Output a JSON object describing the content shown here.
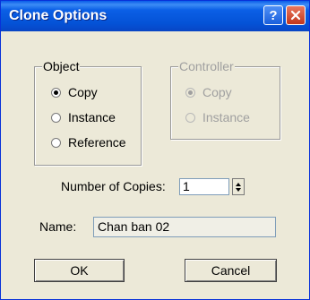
{
  "window": {
    "title": "Clone Options",
    "help_label": "?"
  },
  "object_group": {
    "legend": "Object",
    "options": [
      {
        "label": "Copy",
        "selected": true
      },
      {
        "label": "Instance",
        "selected": false
      },
      {
        "label": "Reference",
        "selected": false
      }
    ]
  },
  "controller_group": {
    "legend": "Controller",
    "enabled": false,
    "options": [
      {
        "label": "Copy",
        "selected": true
      },
      {
        "label": "Instance",
        "selected": false
      }
    ]
  },
  "copies": {
    "label": "Number of Copies:",
    "value": "1"
  },
  "name": {
    "label": "Name:",
    "value": "Chan ban 02"
  },
  "buttons": {
    "ok": "OK",
    "cancel": "Cancel"
  }
}
